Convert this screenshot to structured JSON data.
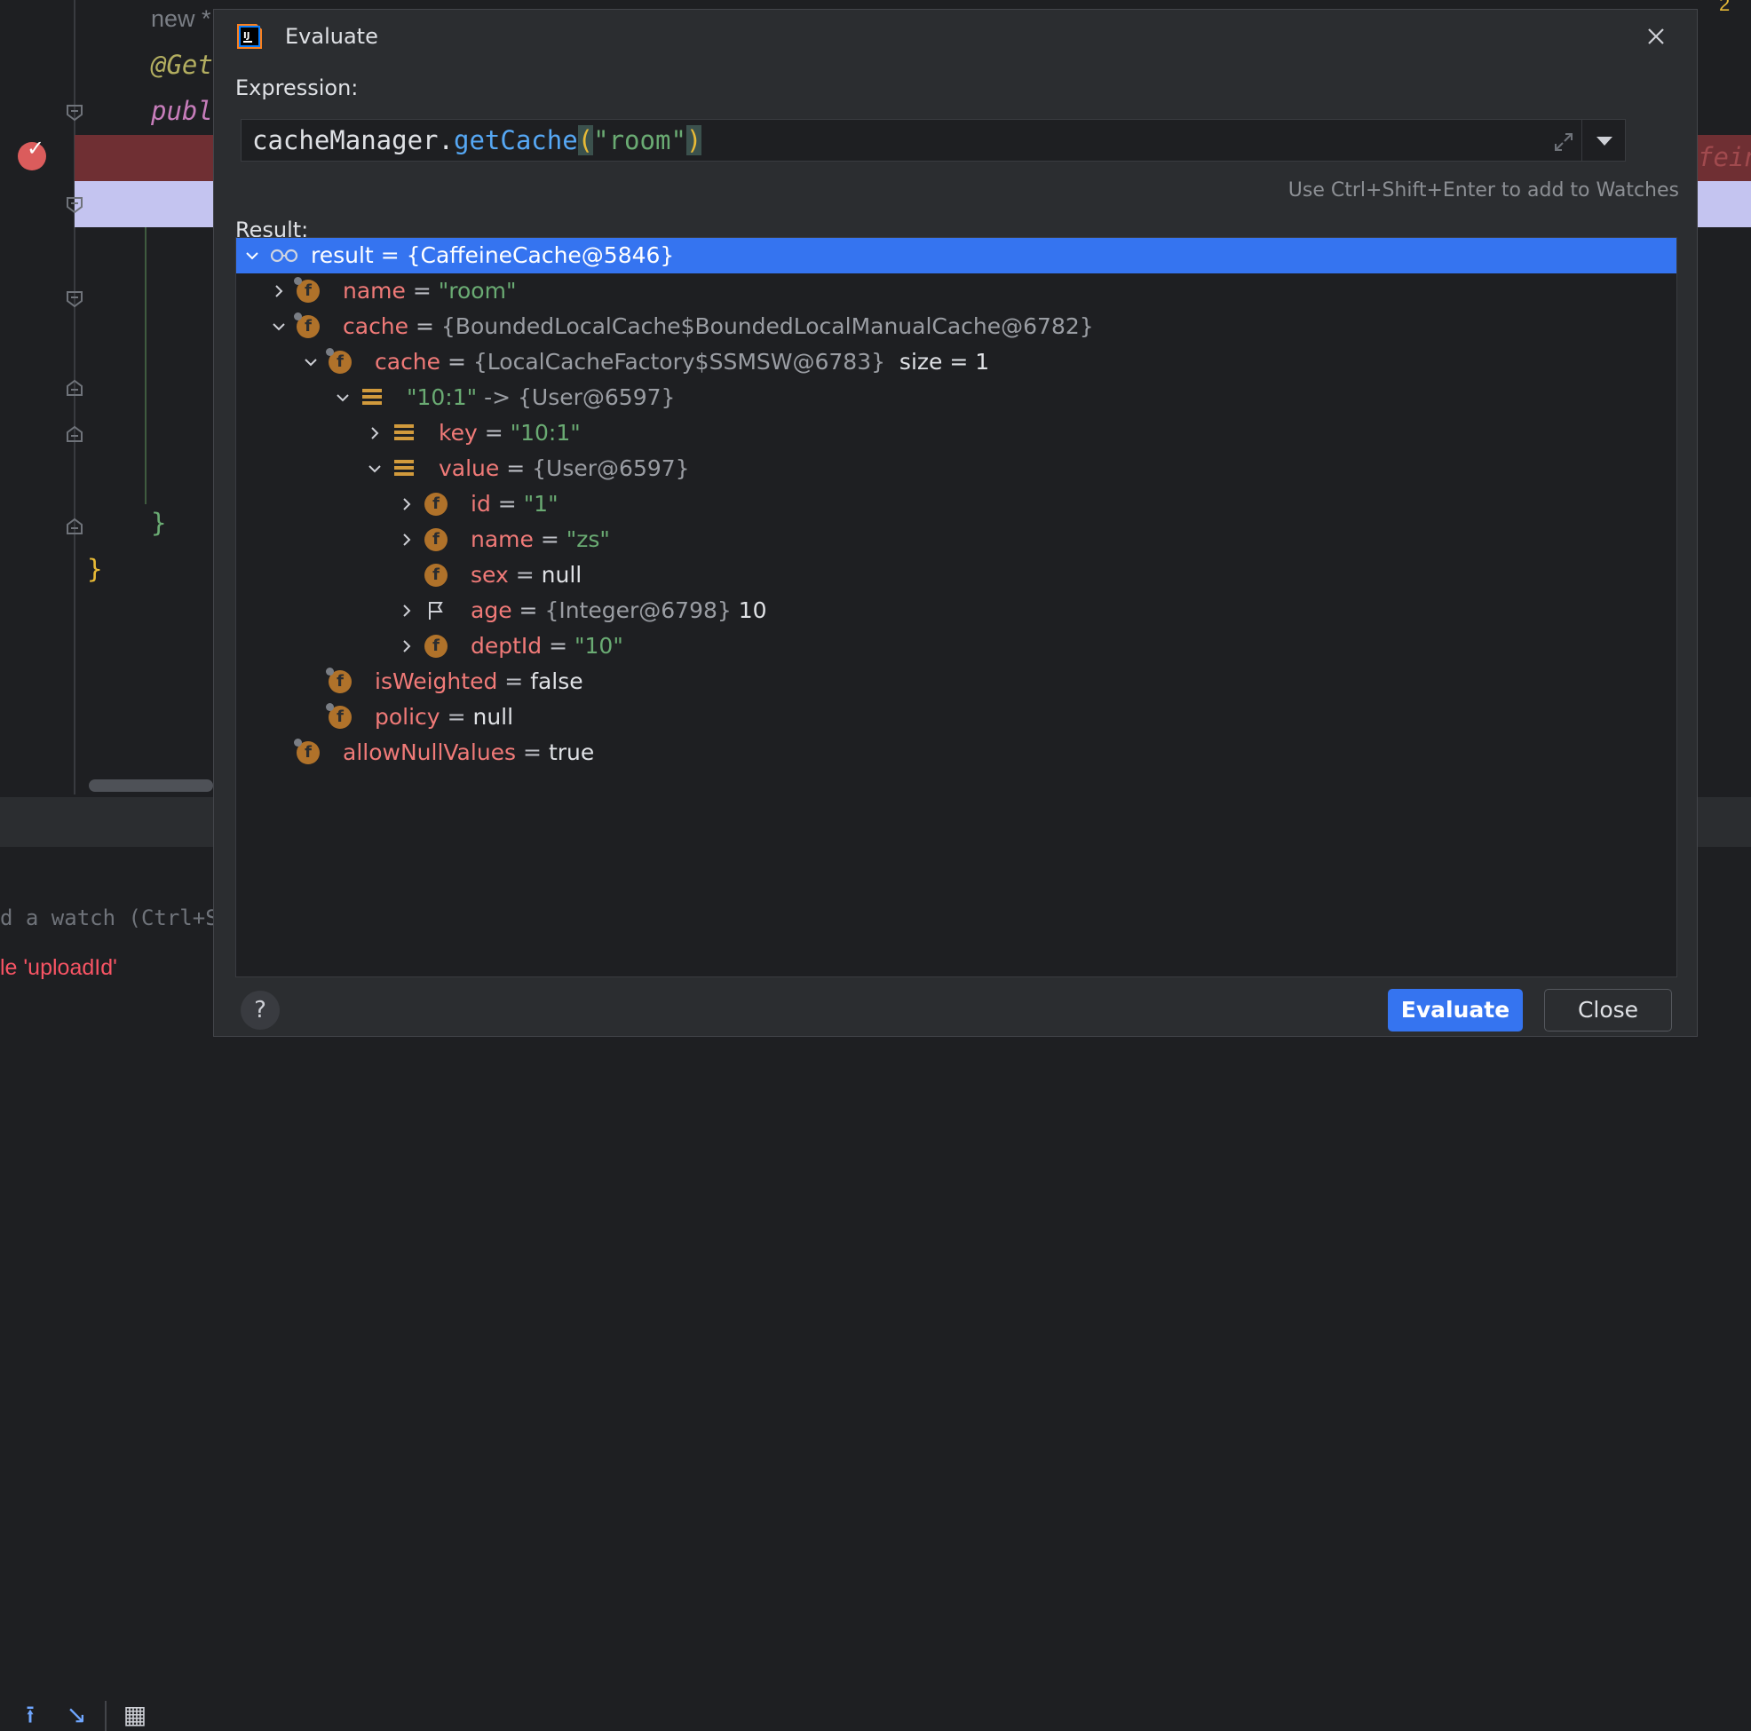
{
  "background": {
    "code_line_new": "new *",
    "code_line_anno": "@Get",
    "code_line_publ": "publ",
    "code_brace_inner": "}",
    "code_brace_outer": "}",
    "right_faded": "fein",
    "watch_placeholder": "d a watch (Ctrl+Sh",
    "error_text": "le 'uploadId'",
    "top_right_badge": "2"
  },
  "dialog": {
    "title": "Evaluate",
    "expression_label": "Expression:",
    "expression": {
      "part1": "cacheManager",
      "dot": ".",
      "method": "getCache",
      "open_paren": "(",
      "arg": "\"room\"",
      "close_paren": ")"
    },
    "hint": "Use Ctrl+Shift+Enter to add to Watches",
    "result_label_first": "R",
    "result_label_rest": "esult:",
    "evaluate_button": "Evaluate",
    "close_button": "Close",
    "help_button": "?"
  },
  "tree": {
    "rows": [
      {
        "name": "result",
        "eq": "=",
        "value": "{CaffeineCache@5846}"
      },
      {
        "name": "name",
        "eq": "=",
        "value": "\"room\""
      },
      {
        "name": "cache",
        "eq": "=",
        "value": "{BoundedLocalCache$BoundedLocalManualCache@6782}"
      },
      {
        "name": "cache",
        "eq": "=",
        "value": "{LocalCacheFactory$SSMSW@6783}",
        "extra": "size = 1"
      },
      {
        "name": "\"10:1\"",
        "eq": "->",
        "value": "{User@6597}"
      },
      {
        "name": "key",
        "eq": "=",
        "value": "\"10:1\""
      },
      {
        "name": "value",
        "eq": "=",
        "value": "{User@6597}"
      },
      {
        "name": "id",
        "eq": "=",
        "value": "\"1\""
      },
      {
        "name": "name",
        "eq": "=",
        "value": "\"zs\""
      },
      {
        "name": "sex",
        "eq": "=",
        "value": "null"
      },
      {
        "name": "age",
        "eq": "=",
        "value": "{Integer@6798}",
        "extra": "10"
      },
      {
        "name": "deptId",
        "eq": "=",
        "value": "\"10\""
      },
      {
        "name": "isWeighted",
        "eq": "=",
        "value": "false"
      },
      {
        "name": "policy",
        "eq": "=",
        "value": "null"
      },
      {
        "name": "allowNullValues",
        "eq": "=",
        "value": "true"
      }
    ]
  },
  "colors": {
    "selection": "#3574f0",
    "field_name": "#f07a78",
    "string_value": "#6aab73",
    "object_value": "#9a9da3",
    "field_icon": "#b0722a"
  }
}
